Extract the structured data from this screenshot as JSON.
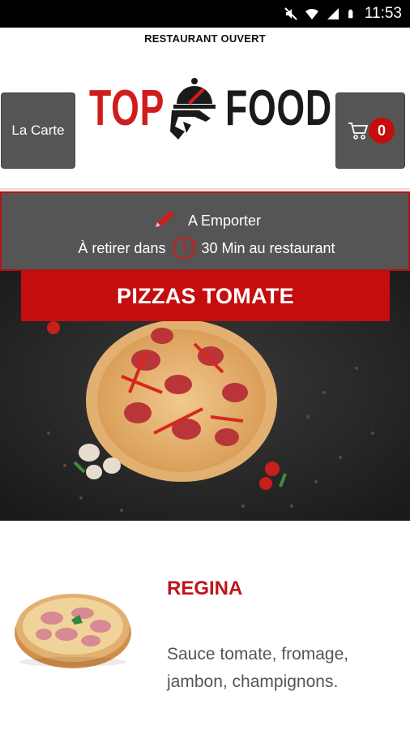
{
  "status_bar": {
    "time": "11:53",
    "icons": [
      "mute-icon",
      "wifi-icon",
      "signal-icon",
      "battery-icon"
    ]
  },
  "notice": {
    "text": "RESTAURANT OUVERT"
  },
  "header": {
    "menu_button_label": "La Carte",
    "logo_left": "TOP",
    "logo_right": "FOOD",
    "cart_count": "0"
  },
  "order_info": {
    "mode": "A Emporter",
    "pickup_prefix": "À retirer dans",
    "pickup_time": "30 Min au restaurant"
  },
  "section": {
    "title": "PIZZAS TOMATE"
  },
  "product": {
    "name": "REGINA",
    "description": "Sauce tomate, fromage, jambon, champignons."
  },
  "colors": {
    "brand_red": "#c40d0d",
    "panel_gray": "#555555",
    "status_bar": "#000000"
  }
}
